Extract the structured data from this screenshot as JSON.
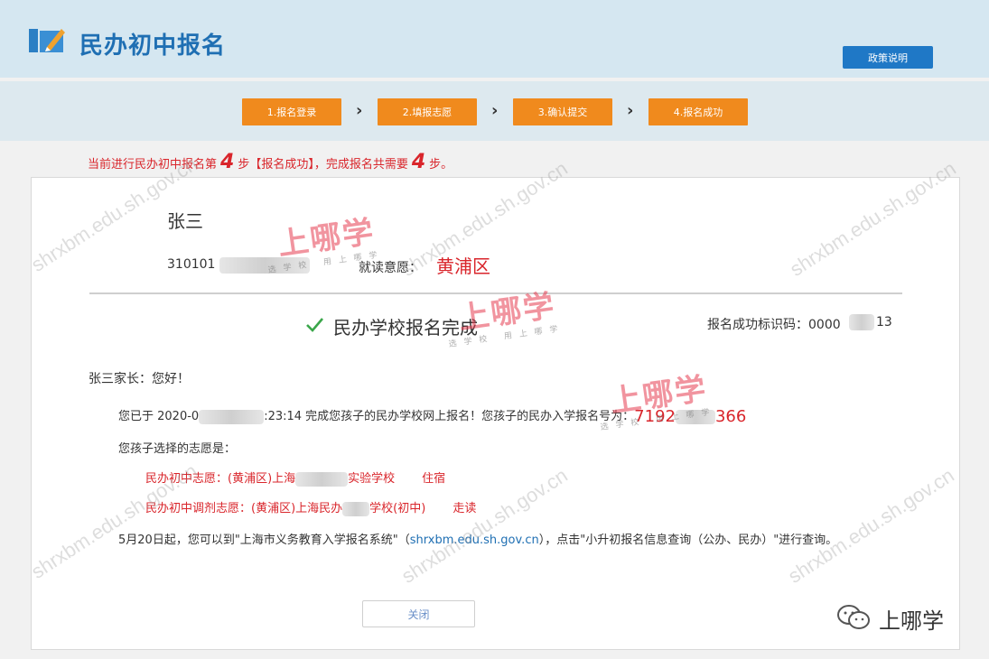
{
  "header": {
    "app_title": "民办初中报名",
    "policy_button": "政策说明",
    "logo_icon": "edit-book-icon",
    "accent_color": "#1f6fb3"
  },
  "steps": [
    {
      "label": "1.报名登录"
    },
    {
      "label": "2.填报志愿"
    },
    {
      "label": "3.确认提交"
    },
    {
      "label": "4.报名成功"
    }
  ],
  "step_arrow": "›",
  "progress": {
    "prefix": "当前进行民办初中报名第",
    "current": "4",
    "middle": "步【报名成功】，完成报名共需要",
    "total": "4",
    "suffix": "步。"
  },
  "student": {
    "name": "张三",
    "id_prefix": "310101",
    "pref_label": "就读意愿：",
    "district": "黄浦区"
  },
  "result": {
    "title": "民办学校报名完成",
    "success_id_label": "报名成功标识码：0000",
    "success_id_tail": "13"
  },
  "message": {
    "greeting": "张三家长：您好！",
    "para1_prefix": "您已于 2020-0",
    "para1_time": ":23:14 完成您孩子的民办学校网上报名！您孩子的民办入学报名号为：",
    "code_prefix": "7192",
    "code_suffix": "366",
    "para2": "您孩子选择的志愿是：",
    "choice1_prefix": "民办初中志愿：(黄浦区)上海",
    "choice1_suffix": "实验学校",
    "choice1_mode": "住宿",
    "choice2_prefix": "民办初中调剂志愿：(黄浦区)上海民办",
    "choice2_suffix": "学校(初中)",
    "choice2_mode": "走读",
    "para3_prefix": "5月20日起，您可以到\"上海市义务教育入学报名系统\"（",
    "para3_link": "shrxbm.edu.sh.gov.cn",
    "para3_suffix": "），点击\"小升初报名信息查询（公办、民办）\"进行查询。"
  },
  "close_button": "关闭",
  "watermark": {
    "site": "shrxbm.edu.sh.gov.cn",
    "brand": "上哪学",
    "brand_slogan": "选学校  用上哪学"
  },
  "footer_brand": {
    "icon": "wechat-icon",
    "label": "上哪学"
  }
}
